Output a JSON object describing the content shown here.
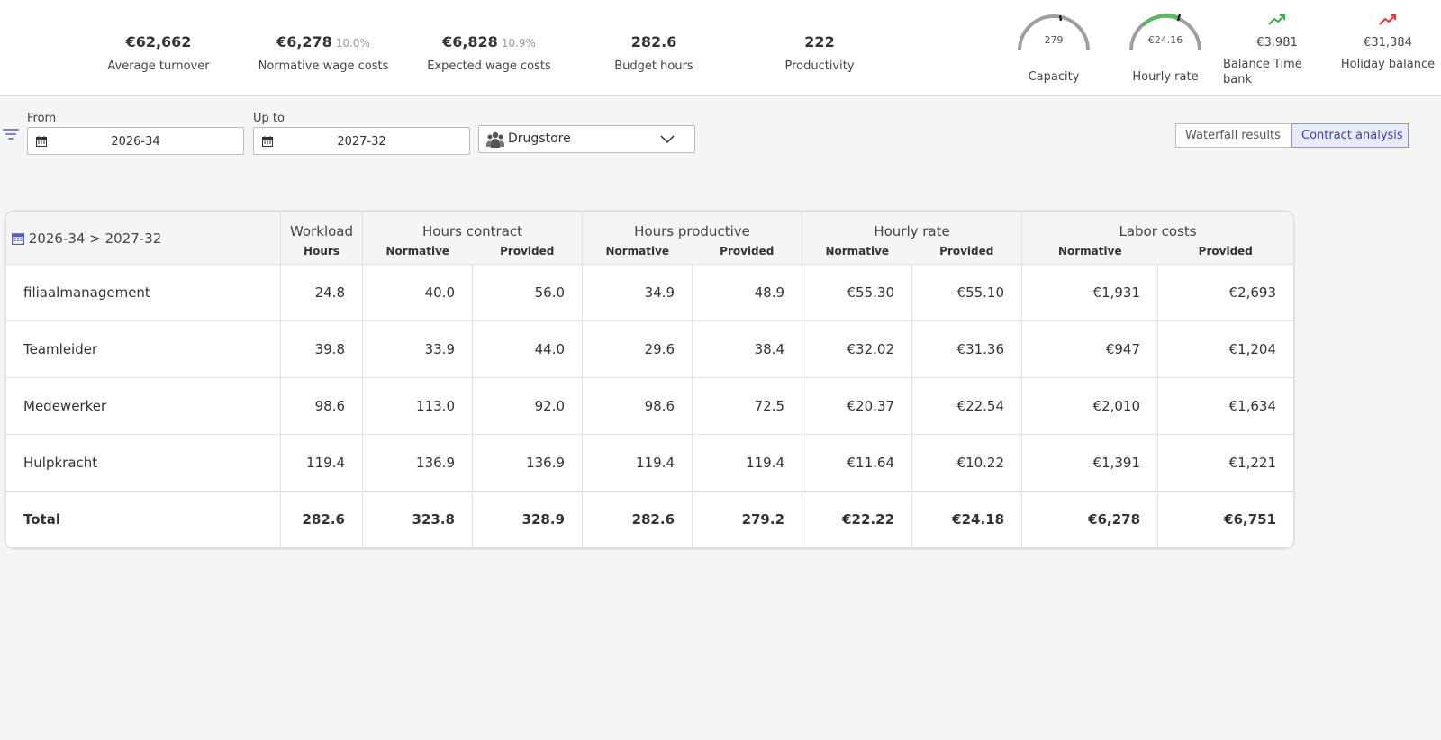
{
  "kpis": {
    "average_turnover": {
      "value": "€62,662",
      "label": "Average turnover"
    },
    "normative_wage": {
      "value": "€6,278",
      "pct": "10.0%",
      "label": "Normative wage costs"
    },
    "expected_wage": {
      "value": "€6,828",
      "pct": "10.9%",
      "label": "Expected wage costs"
    },
    "budget_hours": {
      "value": "282.6",
      "label": "Budget hours"
    },
    "productivity": {
      "value": "222",
      "label": "Productivity"
    }
  },
  "gauges": {
    "capacity": {
      "value": "279",
      "label": "Capacity",
      "fill_fraction": 0.5,
      "fill_color": "#9e9e9e"
    },
    "hourly_rate": {
      "value": "€24.16",
      "label": "Hourly rate",
      "fill_fraction": 0.64,
      "fill_color": "#5cb85c"
    }
  },
  "trends": {
    "balance_time_bank": {
      "value": "€3,981",
      "label": "Balance Time bank",
      "color": "#3cb043",
      "icon": "trend-up-icon"
    },
    "holiday_balance": {
      "value": "€31,384",
      "label": "Holiday balance",
      "color": "#e53935",
      "icon": "trend-up-icon"
    }
  },
  "filters": {
    "from": {
      "label": "From",
      "value": "2026-34"
    },
    "up_to": {
      "label": "Up to",
      "value": "2027-32"
    },
    "department": {
      "value": "Drugstore"
    }
  },
  "view_toggle": {
    "waterfall": "Waterfall results",
    "contract": "Contract analysis",
    "active": "contract"
  },
  "table": {
    "period": "2026-34 > 2027-32",
    "groups": {
      "workload": "Workload",
      "hours_contract": "Hours contract",
      "hours_productive": "Hours productive",
      "hourly_rate": "Hourly rate",
      "labor_costs": "Labor costs"
    },
    "sub": {
      "hours": "Hours",
      "normative": "Normative",
      "provided": "Provided"
    },
    "rows": [
      {
        "name": "filiaalmanagement",
        "cells": [
          "24.8",
          "40.0",
          "56.0",
          "34.9",
          "48.9",
          "€55.30",
          "€55.10",
          "€1,931",
          "€2,693"
        ]
      },
      {
        "name": "Teamleider",
        "cells": [
          "39.8",
          "33.9",
          "44.0",
          "29.6",
          "38.4",
          "€32.02",
          "€31.36",
          "€947",
          "€1,204"
        ]
      },
      {
        "name": "Medewerker",
        "cells": [
          "98.6",
          "113.0",
          "92.0",
          "98.6",
          "72.5",
          "€20.37",
          "€22.54",
          "€2,010",
          "€1,634"
        ]
      },
      {
        "name": "Hulpkracht",
        "cells": [
          "119.4",
          "136.9",
          "136.9",
          "119.4",
          "119.4",
          "€11.64",
          "€10.22",
          "€1,391",
          "€1,221"
        ]
      }
    ],
    "total": {
      "name": "Total",
      "cells": [
        "282.6",
        "323.8",
        "328.9",
        "282.6",
        "279.2",
        "€22.22",
        "€24.18",
        "€6,278",
        "€6,751"
      ]
    }
  },
  "colors": {
    "accent": "#3a42a8",
    "accent_bg": "#e9ebfb",
    "gauge_track": "#9e9e9e",
    "gauge_green": "#5cb85c"
  }
}
